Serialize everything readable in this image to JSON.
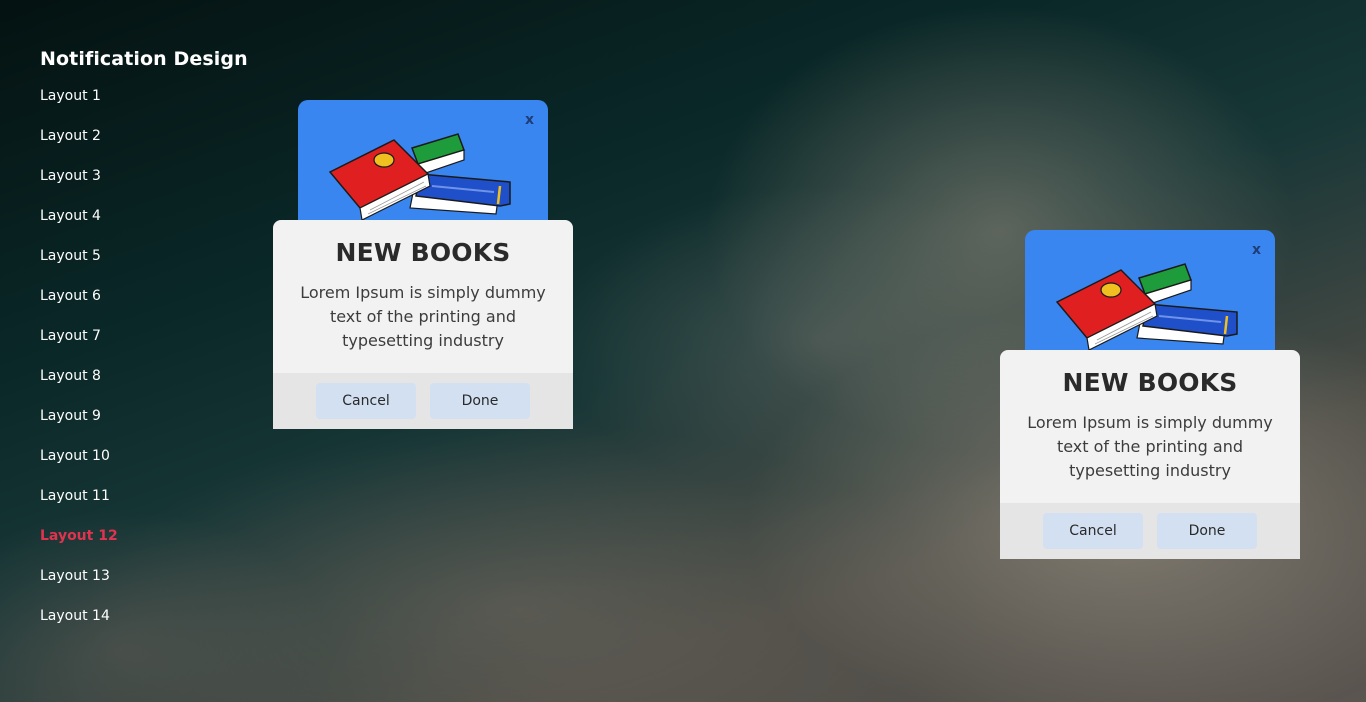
{
  "sidebar": {
    "title": "Notification Design",
    "items": [
      {
        "label": "Layout 1"
      },
      {
        "label": "Layout 2"
      },
      {
        "label": "Layout 3"
      },
      {
        "label": "Layout 4"
      },
      {
        "label": "Layout 5"
      },
      {
        "label": "Layout 6"
      },
      {
        "label": "Layout 7"
      },
      {
        "label": "Layout 8"
      },
      {
        "label": "Layout 9"
      },
      {
        "label": "Layout 10"
      },
      {
        "label": "Layout 11"
      },
      {
        "label": "Layout 12"
      },
      {
        "label": "Layout 13"
      },
      {
        "label": "Layout 14"
      }
    ],
    "active_item": "Layout 12"
  },
  "notifications": [
    {
      "close_label": "x",
      "illustration_icon": "books-illustration-icon",
      "title": "NEW BOOKS",
      "body": "Lorem Ipsum is simply dummy text of the printing and typesetting industry",
      "cancel_label": "Cancel",
      "done_label": "Done"
    },
    {
      "close_label": "x",
      "illustration_icon": "books-illustration-icon",
      "title": "NEW BOOKS",
      "body": "Lorem Ipsum is simply dummy text of the printing and typesetting industry",
      "cancel_label": "Cancel",
      "done_label": "Done"
    }
  ],
  "colors": {
    "accent_active": "#e0334f",
    "image_background": "#3a86f0",
    "card_background": "#f2f2f2",
    "actions_background": "#e5e5e5",
    "button_background": "#d3e0f2"
  }
}
